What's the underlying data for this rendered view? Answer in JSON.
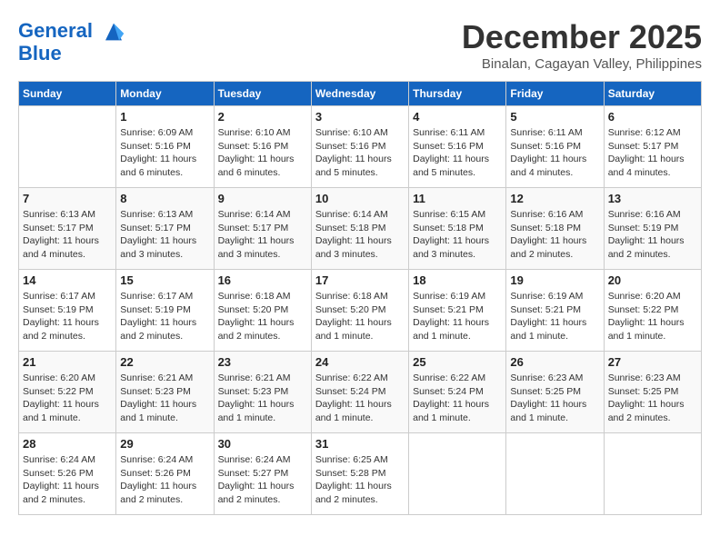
{
  "header": {
    "logo_line1": "General",
    "logo_line2": "Blue",
    "month_title": "December 2025",
    "subtitle": "Binalan, Cagayan Valley, Philippines"
  },
  "days_of_week": [
    "Sunday",
    "Monday",
    "Tuesday",
    "Wednesday",
    "Thursday",
    "Friday",
    "Saturday"
  ],
  "weeks": [
    [
      {
        "day": "",
        "info": ""
      },
      {
        "day": "1",
        "info": "Sunrise: 6:09 AM\nSunset: 5:16 PM\nDaylight: 11 hours\nand 6 minutes."
      },
      {
        "day": "2",
        "info": "Sunrise: 6:10 AM\nSunset: 5:16 PM\nDaylight: 11 hours\nand 6 minutes."
      },
      {
        "day": "3",
        "info": "Sunrise: 6:10 AM\nSunset: 5:16 PM\nDaylight: 11 hours\nand 5 minutes."
      },
      {
        "day": "4",
        "info": "Sunrise: 6:11 AM\nSunset: 5:16 PM\nDaylight: 11 hours\nand 5 minutes."
      },
      {
        "day": "5",
        "info": "Sunrise: 6:11 AM\nSunset: 5:16 PM\nDaylight: 11 hours\nand 4 minutes."
      },
      {
        "day": "6",
        "info": "Sunrise: 6:12 AM\nSunset: 5:17 PM\nDaylight: 11 hours\nand 4 minutes."
      }
    ],
    [
      {
        "day": "7",
        "info": "Sunrise: 6:13 AM\nSunset: 5:17 PM\nDaylight: 11 hours\nand 4 minutes."
      },
      {
        "day": "8",
        "info": "Sunrise: 6:13 AM\nSunset: 5:17 PM\nDaylight: 11 hours\nand 3 minutes."
      },
      {
        "day": "9",
        "info": "Sunrise: 6:14 AM\nSunset: 5:17 PM\nDaylight: 11 hours\nand 3 minutes."
      },
      {
        "day": "10",
        "info": "Sunrise: 6:14 AM\nSunset: 5:18 PM\nDaylight: 11 hours\nand 3 minutes."
      },
      {
        "day": "11",
        "info": "Sunrise: 6:15 AM\nSunset: 5:18 PM\nDaylight: 11 hours\nand 3 minutes."
      },
      {
        "day": "12",
        "info": "Sunrise: 6:16 AM\nSunset: 5:18 PM\nDaylight: 11 hours\nand 2 minutes."
      },
      {
        "day": "13",
        "info": "Sunrise: 6:16 AM\nSunset: 5:19 PM\nDaylight: 11 hours\nand 2 minutes."
      }
    ],
    [
      {
        "day": "14",
        "info": "Sunrise: 6:17 AM\nSunset: 5:19 PM\nDaylight: 11 hours\nand 2 minutes."
      },
      {
        "day": "15",
        "info": "Sunrise: 6:17 AM\nSunset: 5:19 PM\nDaylight: 11 hours\nand 2 minutes."
      },
      {
        "day": "16",
        "info": "Sunrise: 6:18 AM\nSunset: 5:20 PM\nDaylight: 11 hours\nand 2 minutes."
      },
      {
        "day": "17",
        "info": "Sunrise: 6:18 AM\nSunset: 5:20 PM\nDaylight: 11 hours\nand 1 minute."
      },
      {
        "day": "18",
        "info": "Sunrise: 6:19 AM\nSunset: 5:21 PM\nDaylight: 11 hours\nand 1 minute."
      },
      {
        "day": "19",
        "info": "Sunrise: 6:19 AM\nSunset: 5:21 PM\nDaylight: 11 hours\nand 1 minute."
      },
      {
        "day": "20",
        "info": "Sunrise: 6:20 AM\nSunset: 5:22 PM\nDaylight: 11 hours\nand 1 minute."
      }
    ],
    [
      {
        "day": "21",
        "info": "Sunrise: 6:20 AM\nSunset: 5:22 PM\nDaylight: 11 hours\nand 1 minute."
      },
      {
        "day": "22",
        "info": "Sunrise: 6:21 AM\nSunset: 5:23 PM\nDaylight: 11 hours\nand 1 minute."
      },
      {
        "day": "23",
        "info": "Sunrise: 6:21 AM\nSunset: 5:23 PM\nDaylight: 11 hours\nand 1 minute."
      },
      {
        "day": "24",
        "info": "Sunrise: 6:22 AM\nSunset: 5:24 PM\nDaylight: 11 hours\nand 1 minute."
      },
      {
        "day": "25",
        "info": "Sunrise: 6:22 AM\nSunset: 5:24 PM\nDaylight: 11 hours\nand 1 minute."
      },
      {
        "day": "26",
        "info": "Sunrise: 6:23 AM\nSunset: 5:25 PM\nDaylight: 11 hours\nand 1 minute."
      },
      {
        "day": "27",
        "info": "Sunrise: 6:23 AM\nSunset: 5:25 PM\nDaylight: 11 hours\nand 2 minutes."
      }
    ],
    [
      {
        "day": "28",
        "info": "Sunrise: 6:24 AM\nSunset: 5:26 PM\nDaylight: 11 hours\nand 2 minutes."
      },
      {
        "day": "29",
        "info": "Sunrise: 6:24 AM\nSunset: 5:26 PM\nDaylight: 11 hours\nand 2 minutes."
      },
      {
        "day": "30",
        "info": "Sunrise: 6:24 AM\nSunset: 5:27 PM\nDaylight: 11 hours\nand 2 minutes."
      },
      {
        "day": "31",
        "info": "Sunrise: 6:25 AM\nSunset: 5:28 PM\nDaylight: 11 hours\nand 2 minutes."
      },
      {
        "day": "",
        "info": ""
      },
      {
        "day": "",
        "info": ""
      },
      {
        "day": "",
        "info": ""
      }
    ]
  ]
}
